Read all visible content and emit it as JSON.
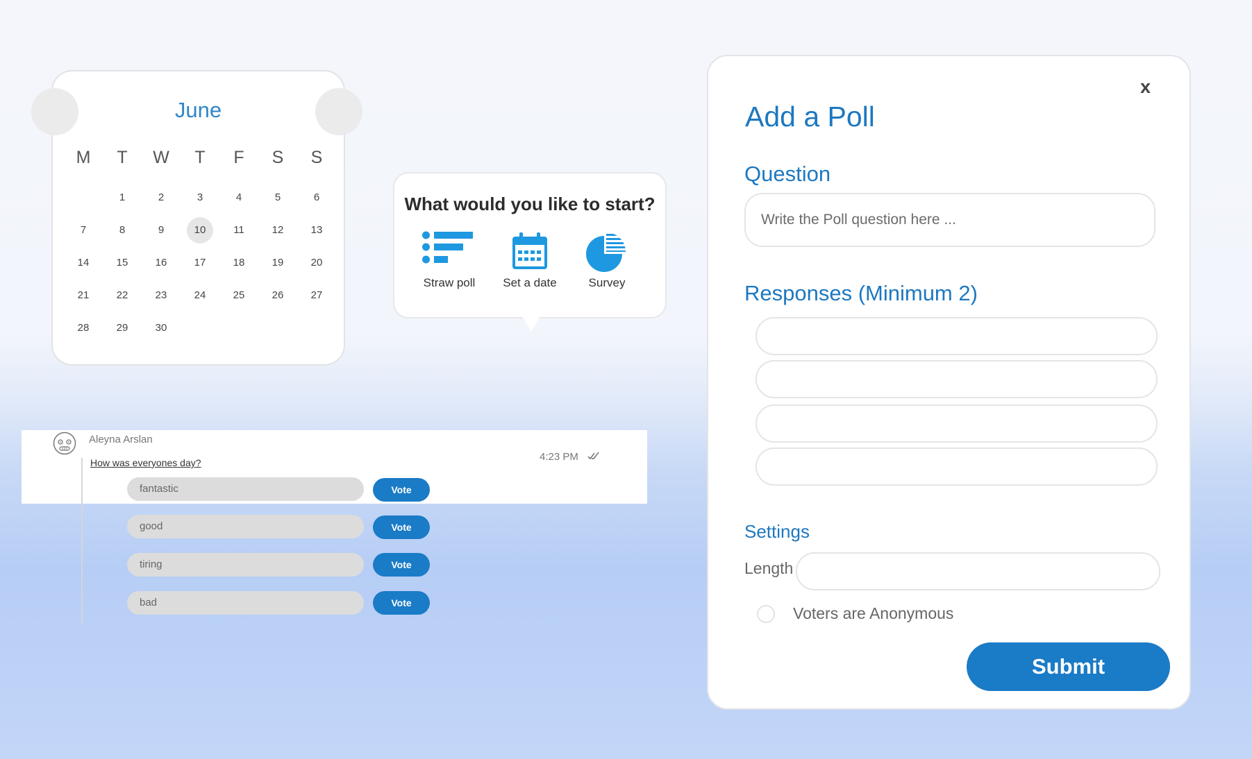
{
  "calendar": {
    "month": "June",
    "weekdays": [
      "M",
      "T",
      "W",
      "T",
      "F",
      "S",
      "S"
    ],
    "selected_day": "10",
    "weeks": [
      [
        "",
        "1",
        "2",
        "3",
        "4",
        "5",
        "6"
      ],
      [
        "7",
        "8",
        "9",
        "10",
        "11",
        "12",
        "13"
      ],
      [
        "14",
        "15",
        "16",
        "17",
        "18",
        "19",
        "20"
      ],
      [
        "21",
        "22",
        "23",
        "24",
        "25",
        "26",
        "27"
      ],
      [
        "28",
        "29",
        "30",
        "",
        "",
        "",
        ""
      ]
    ]
  },
  "start_popup": {
    "title": "What would you like to start?",
    "options": [
      {
        "label": "Straw poll",
        "icon": "straw-poll-icon"
      },
      {
        "label": "Set a date",
        "icon": "calendar-icon"
      },
      {
        "label": "Survey",
        "icon": "pie-chart-icon"
      }
    ]
  },
  "chat": {
    "sender": "Aleyna Arslan",
    "question": "How was everyones day?",
    "time": "4:23 PM",
    "options": [
      {
        "label": "fantastic",
        "vote": "Vote"
      },
      {
        "label": "good",
        "vote": "Vote"
      },
      {
        "label": "tiring",
        "vote": "Vote"
      },
      {
        "label": "bad",
        "vote": "Vote"
      }
    ]
  },
  "poll_form": {
    "close": "x",
    "title": "Add a Poll",
    "question_label": "Question",
    "question_placeholder": "Write the Poll question here ...",
    "responses_label": "Responses (Minimum 2)",
    "responses": [
      "",
      "",
      "",
      ""
    ],
    "settings_label": "Settings",
    "length_label": "Length",
    "length_value": "",
    "anonymous_label": "Voters are Anonymous",
    "anonymous_checked": false,
    "submit": "Submit"
  },
  "colors": {
    "accent": "#1d78c0",
    "button": "#1a7bc6",
    "icon_blue": "#1e98e0"
  }
}
